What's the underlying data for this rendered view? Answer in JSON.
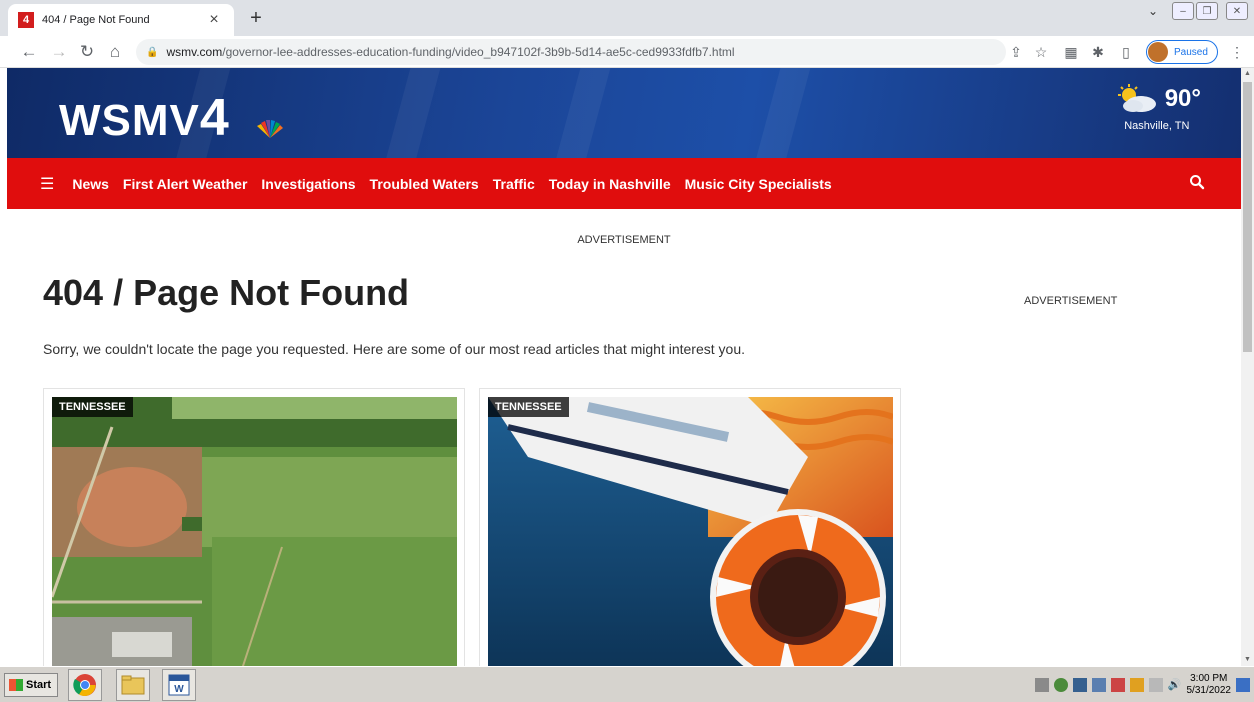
{
  "browser": {
    "tab_title": "404 / Page Not Found",
    "favicon_text": "4",
    "new_tab_symbol": "+",
    "url_domain": "wsmv.com",
    "url_path": "/governor-lee-addresses-education-funding/video_b947102f-3b9b-5d14-ae5c-ced9933fdfb7.html",
    "profile_status": "Paused"
  },
  "site": {
    "logo_text": "WSMV",
    "logo_number": "4",
    "weather": {
      "temp": "90°",
      "city": "Nashville, TN"
    },
    "nav_items": [
      "News",
      "First Alert Weather",
      "Investigations",
      "Troubled Waters",
      "Traffic",
      "Today in Nashville",
      "Music City Specialists"
    ]
  },
  "content": {
    "ad_label_top": "ADVERTISEMENT",
    "ad_label_right": "ADVERTISEMENT",
    "title": "404 / Page Not Found",
    "message": "Sorry, we couldn't locate the page you requested. Here are some of our most read articles that might interest you.",
    "cards": [
      {
        "tag": "TENNESSEE"
      },
      {
        "tag": "TENNESSEE"
      }
    ]
  },
  "taskbar": {
    "start_label": "Start",
    "time": "3:00 PM",
    "date": "5/31/2022"
  },
  "colors": {
    "nav_red": "#e00d0d",
    "header_blue": "#1b4597"
  }
}
